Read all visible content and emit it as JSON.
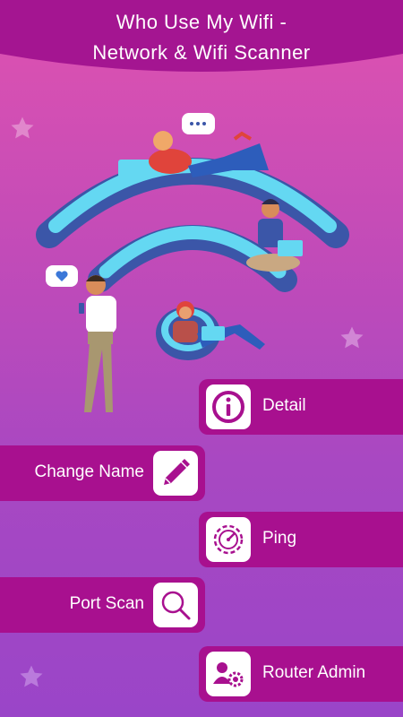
{
  "header": {
    "title_line1": "Who Use My Wifi -",
    "title_line2": "Network & Wifi Scanner"
  },
  "menu": {
    "detail": {
      "label": "Detail",
      "icon": "info-icon"
    },
    "change_name": {
      "label": "Change Name",
      "icon": "pencil-icon"
    },
    "ping": {
      "label": "Ping",
      "icon": "speedometer-gear-icon"
    },
    "port_scan": {
      "label": "Port Scan",
      "icon": "magnifier-icon"
    },
    "router_admin": {
      "label": "Router Admin",
      "icon": "users-gear-icon"
    }
  },
  "colors": {
    "menu_bg": "#a8108f",
    "header_bg": "#a41591",
    "icon_color": "#a8108f"
  }
}
